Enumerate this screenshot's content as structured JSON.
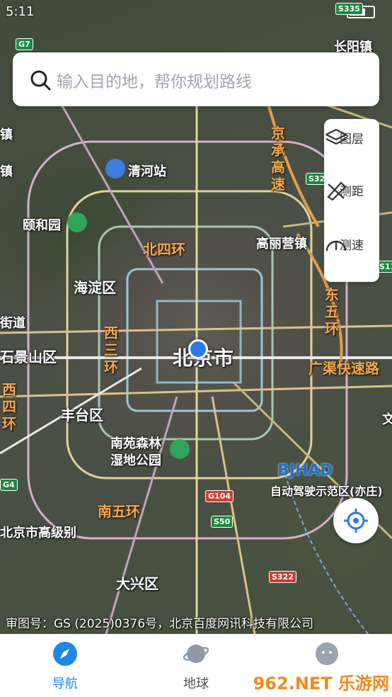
{
  "status": {
    "time": "5:11"
  },
  "search": {
    "placeholder": "输入目的地，帮你规划路线"
  },
  "tools": [
    {
      "label": "图层",
      "icon": "layers-icon"
    },
    {
      "label": "测距",
      "icon": "ruler-icon"
    },
    {
      "label": "测速",
      "icon": "speedometer-icon"
    }
  ],
  "map": {
    "city": "北京市",
    "districts": [
      "海淀区",
      "石景山区",
      "丰台区",
      "大兴区"
    ],
    "places": [
      "清河站",
      "颐和园",
      "南苑森林",
      "湿地公园",
      "望京街道",
      "高丽营镇",
      "长阳镇",
      "北京市高级别",
      "自动驾驶示范区(亦庄)"
    ],
    "roads": [
      "京承高速",
      "北四环",
      "东五环",
      "西三环",
      "西四环",
      "南五环",
      "广渠快速路"
    ],
    "shields": [
      "G7",
      "S32",
      "G4",
      "G104",
      "S50",
      "S322",
      "S11",
      "S335"
    ],
    "brand": "BJHAD",
    "edge_labels": [
      "镇",
      "镇",
      "街道",
      "文"
    ]
  },
  "legal": "审图号：GS (2025)0376号，北京百度网讯科技有限公司",
  "tabs": [
    {
      "label": "导航",
      "icon": "compass-icon",
      "active": true,
      "color": "#1e88e5"
    },
    {
      "label": "地球",
      "icon": "planet-icon",
      "active": false,
      "color": "#555555"
    },
    {
      "label": "",
      "icon": "profile-icon",
      "active": false,
      "color": "#555555"
    }
  ],
  "watermark": "962.NET 乐游网"
}
